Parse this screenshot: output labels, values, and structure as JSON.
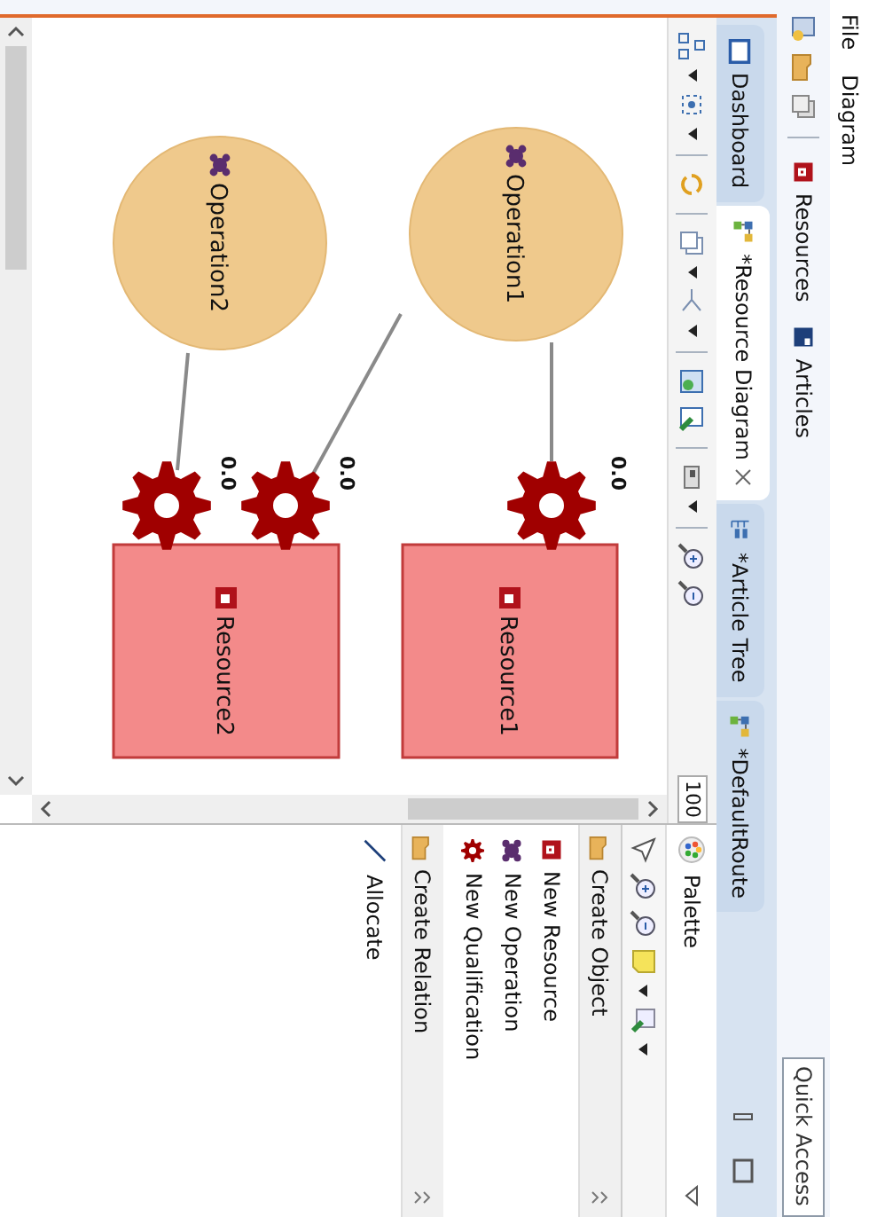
{
  "menu": [
    {
      "label": "File"
    },
    {
      "label": "Diagram"
    }
  ],
  "toolbar": {
    "perspectives": [
      {
        "label": "Resources",
        "kind": "resource"
      },
      {
        "label": "Articles",
        "kind": "article"
      }
    ],
    "quick_access": {
      "placeholder": "Quick Access"
    }
  },
  "tabs": [
    {
      "label": "Dashboard",
      "selected": false,
      "kind": "dashboard"
    },
    {
      "label": "*Resource Diagram",
      "selected": true,
      "kind": "diagram"
    },
    {
      "label": "*Article Tree",
      "selected": false,
      "kind": "tree"
    },
    {
      "label": "*DefaultRoute",
      "selected": false,
      "kind": "diagram"
    }
  ],
  "diagram_toolbar": {
    "zoom": "100"
  },
  "diagram": {
    "operations": [
      {
        "label": "Operation1"
      },
      {
        "label": "Operation2"
      }
    ],
    "resources": [
      {
        "label": "Resource1",
        "qualifications": [
          {
            "value": "0.0"
          }
        ]
      },
      {
        "label": "Resource2",
        "qualifications": [
          {
            "value": "0.0"
          },
          {
            "value": "0.0"
          }
        ]
      }
    ]
  },
  "palette": {
    "title": "Palette",
    "drawers": [
      {
        "label": "Create Object",
        "items": [
          {
            "label": "New Resource",
            "kind": "resource"
          },
          {
            "label": "New Operation",
            "kind": "operation"
          },
          {
            "label": "New Qualification",
            "kind": "qualification"
          }
        ]
      },
      {
        "label": "Create Relation",
        "items": [
          {
            "label": "Allocate",
            "kind": "link"
          }
        ]
      }
    ]
  }
}
